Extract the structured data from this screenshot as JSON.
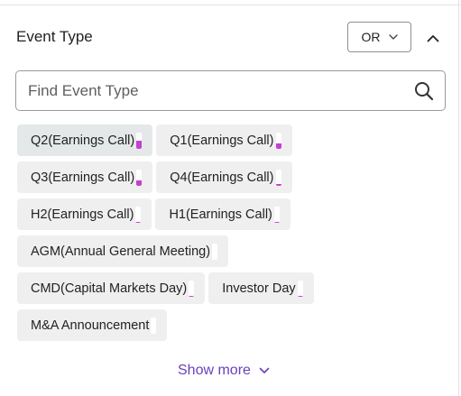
{
  "panel": {
    "title": "Event Type",
    "operator_label": "OR",
    "collapse_icon": "chevron-up-icon"
  },
  "search": {
    "placeholder": "Find Event Type",
    "value": "",
    "icon": "search-icon"
  },
  "chips": [
    {
      "label": "Q2(Earnings Call)",
      "selected": true,
      "level": 0.5
    },
    {
      "label": "Q1(Earnings Call)",
      "selected": false,
      "level": 0.35
    },
    {
      "label": "Q3(Earnings Call)",
      "selected": false,
      "level": 0.35
    },
    {
      "label": "Q4(Earnings Call)",
      "selected": false,
      "level": 0.1
    },
    {
      "label": "H2(Earnings Call)",
      "selected": false,
      "level": 0.05
    },
    {
      "label": "H1(Earnings Call)",
      "selected": false,
      "level": 0.05
    },
    {
      "label": "AGM(Annual General Meeting)",
      "selected": false,
      "level": 0.0
    },
    {
      "label": "CMD(Capital Markets Day)",
      "selected": false,
      "level": 0.05
    },
    {
      "label": "Investor Day",
      "selected": false,
      "level": 0.05
    },
    {
      "label": "M&A Announcement",
      "selected": false,
      "level": 0.0
    }
  ],
  "show_more": {
    "label": "Show more",
    "icon": "chevron-down-icon"
  },
  "colors": {
    "meter_fill": "#c63fd0",
    "link": "#6b3fc0",
    "chip_bg": "#efefef",
    "chip_selected_bg": "#e4e8e8"
  }
}
